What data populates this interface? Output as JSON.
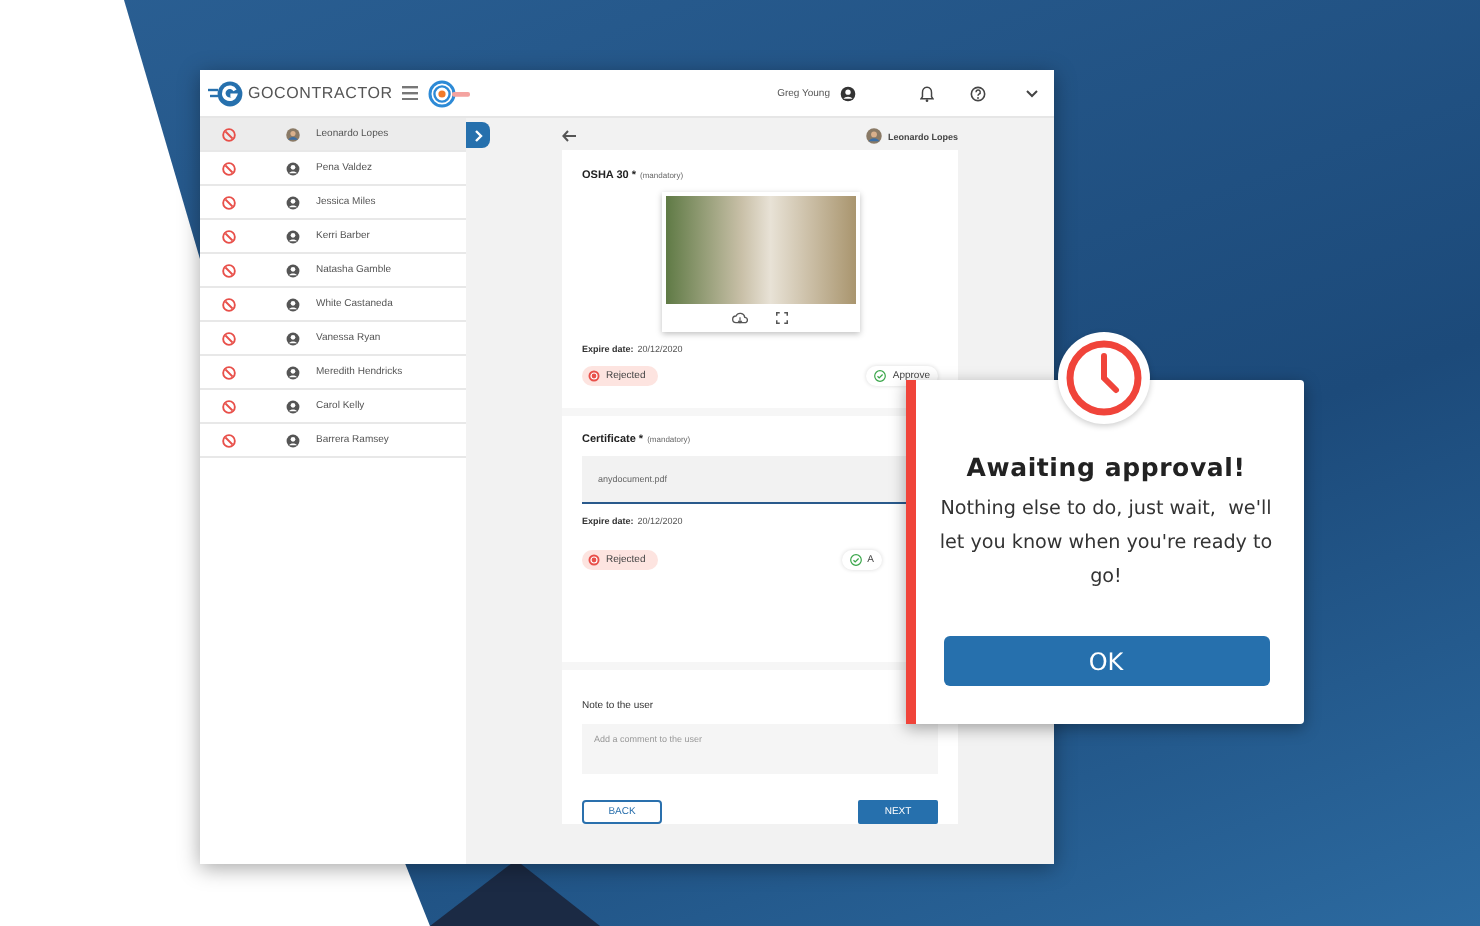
{
  "header": {
    "brand": "GOCONTRACTOR",
    "user": "Greg Young"
  },
  "sidebar": {
    "items": [
      {
        "name": "Leonardo Lopes",
        "kind": "photo",
        "selected": true
      },
      {
        "name": "Pena Valdez",
        "kind": "generic",
        "selected": false
      },
      {
        "name": "Jessica Miles",
        "kind": "generic",
        "selected": false
      },
      {
        "name": "Kerri Barber",
        "kind": "generic",
        "selected": false
      },
      {
        "name": "Natasha Gamble",
        "kind": "generic",
        "selected": false
      },
      {
        "name": "White Castaneda",
        "kind": "generic",
        "selected": false
      },
      {
        "name": "Vanessa Ryan",
        "kind": "generic",
        "selected": false
      },
      {
        "name": "Meredith Hendricks",
        "kind": "generic",
        "selected": false
      },
      {
        "name": "Carol Kelly",
        "kind": "generic",
        "selected": false
      },
      {
        "name": "Barrera Ramsey",
        "kind": "generic",
        "selected": false
      }
    ]
  },
  "main": {
    "user": "Leonardo Lopes",
    "documents": [
      {
        "kind": "image",
        "title": "OSHA 30 *",
        "note": "(mandatory)",
        "expire_label": "Expire date:",
        "expire_value": "20/12/2020",
        "reject_label": "Rejected",
        "approve_label": "Approve"
      },
      {
        "kind": "file",
        "title": "Certificate *",
        "note": "(mandatory)",
        "file_name": "anydocument.pdf",
        "expire_label": "Expire date:",
        "expire_value": "20/12/2020",
        "reject_label": "Rejected",
        "approve_label": "A"
      }
    ],
    "note": {
      "label": "Note to the user",
      "placeholder": "Add a comment to the user"
    },
    "buttons": {
      "back": "BACK",
      "next": "NEXT"
    }
  },
  "dialog": {
    "title": "Awaiting approval!",
    "message": "Nothing else to do, just wait,  we'll let you know when you're ready to go!",
    "button": "OK"
  }
}
